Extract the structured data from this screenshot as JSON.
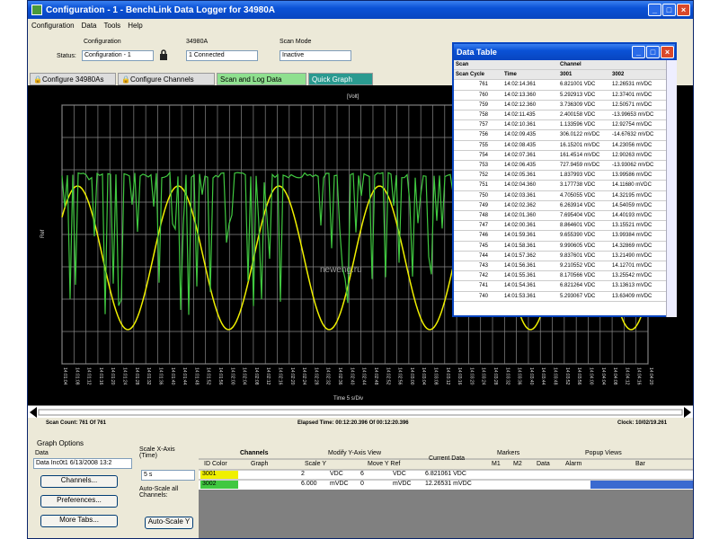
{
  "window": {
    "title": "Configuration - 1 - BenchLink Data Logger for 34980A",
    "buttons": [
      "_",
      "□",
      "×"
    ]
  },
  "menu": [
    "Configuration",
    "Data",
    "Tools",
    "Help"
  ],
  "config": {
    "configuration_label": "Configuration",
    "status_label": "Status:",
    "configuration_value": "Configuration - 1",
    "instrument_label": "34980A",
    "instrument_value": "1 Connected",
    "scan_mode_label": "Scan Mode",
    "scan_mode_value": "Inactive"
  },
  "tabs": [
    {
      "label": "Configure 34980As"
    },
    {
      "label": "Configure Channels"
    },
    {
      "label": "Scan and Log Data"
    },
    {
      "label": "Quick Graph"
    }
  ],
  "plot": {
    "top_label": "[Volt]",
    "y_label": "Ref",
    "x_label": "Time 5 s/Div",
    "legend": [
      "3001",
      "3002"
    ],
    "watermark": "neweng.ru",
    "time_ticks": [
      "14:01:04",
      "14:01:08",
      "14:01:12",
      "14:01:16",
      "14:01:20",
      "14:01:24",
      "14:01:28",
      "14:01:32",
      "14:01:36",
      "14:01:40",
      "14:01:44",
      "14:01:48",
      "14:01:52",
      "14:01:56",
      "14:02:00",
      "14:02:04",
      "14:02:08",
      "14:02:12",
      "14:02:16",
      "14:02:20",
      "14:02:24",
      "14:02:28",
      "14:02:32",
      "14:02:36",
      "14:02:40",
      "14:02:44",
      "14:02:48",
      "14:02:52",
      "14:02:56",
      "14:03:00",
      "14:03:04",
      "14:03:08",
      "14:03:12",
      "14:03:16",
      "14:03:20",
      "14:03:24",
      "14:03:28",
      "14:03:32",
      "14:03:36",
      "14:03:40",
      "14:03:44",
      "14:03:48",
      "14:03:52",
      "14:03:56",
      "14:04:00",
      "14:04:04",
      "14:04:08",
      "14:04:12",
      "14:04:16",
      "14:04:20"
    ],
    "colors": {
      "ch3001": "#f0f000",
      "ch3002": "#40c840",
      "grid": "#cccccc"
    }
  },
  "status_bar": {
    "scan_count": "Scan Count: 761 Of 761",
    "elapsed": "Elapsed Time: 00:12:20.396 Of 00:12:20.396",
    "clock": "Clock: 10/02/19.261"
  },
  "graph_options": {
    "title": "Graph Options",
    "data_label": "Data",
    "data_value": "Data Inc0t1 6/13/2008 13:2",
    "channels_btn": "Channels...",
    "preferences_btn": "Preferences...",
    "more_tabs_btn": "More Tabs...",
    "scale_label": "Scale X-Axis (Time)",
    "scale_value": "5 s",
    "autoscale_label": "Auto-Scale all Channels:",
    "autoscale_btn": "Auto-Scale Y"
  },
  "grid": {
    "headers": {
      "channels": "Channels",
      "id_color": "ID Color",
      "graph": "Graph",
      "modify": "Modify Y-Axis View",
      "scale_y": "Scale Y",
      "move_y": "Move Y Ref",
      "current": "Current Data",
      "markers": "Markers",
      "m1": "M1",
      "m2": "M2",
      "popup": "Popup Views",
      "data": "Data",
      "alarm": "Alarm",
      "bar": "Bar"
    },
    "rows": [
      {
        "id": "3001",
        "color": "#f0f000",
        "scale": "2",
        "scale_unit": "VDC",
        "move": "6",
        "move_unit": "VDC",
        "current": "6.821061 VDC"
      },
      {
        "id": "3002",
        "color": "#40c840",
        "scale": "6.000",
        "scale_unit": "mVDC",
        "move": "0",
        "move_unit": "mVDC",
        "current": "12.26531 mVDC"
      }
    ]
  },
  "data_table": {
    "title": "Data Table",
    "headers": {
      "scan": "Scan",
      "channel": "Channel",
      "scan_cycle": "Scan Cycle",
      "time": "Time",
      "c1": "3001",
      "c2": "3002"
    },
    "rows": [
      [
        "761",
        "14:02:14.361",
        "6.821001 VDC",
        "12.26531 mVDC"
      ],
      [
        "760",
        "14:02:13.360",
        "5.292913 VDC",
        "12.37401 mVDC"
      ],
      [
        "759",
        "14:02:12.360",
        "3.736309 VDC",
        "12.50571 mVDC"
      ],
      [
        "758",
        "14:02:11.435",
        "2.400158 VDC",
        "-13.99653 mVDC"
      ],
      [
        "757",
        "14:02:10.361",
        "1.133596 VDC",
        "12.92754 mVDC"
      ],
      [
        "756",
        "14:02:09.435",
        "306.0122 mVDC",
        "-14.67632 mVDC"
      ],
      [
        "755",
        "14:02:08.435",
        "16.15201 mVDC",
        "14.23056 mVDC"
      ],
      [
        "754",
        "14:02:07.361",
        "161.4514 mVDC",
        "12.90263 mVDC"
      ],
      [
        "753",
        "14:02:06.435",
        "727.9459 mVDC",
        "-13.93062 mVDC"
      ],
      [
        "752",
        "14:02:05.361",
        "1.837993 VDC",
        "13.99586 mVDC"
      ],
      [
        "751",
        "14:02:04.360",
        "3.177738 VDC",
        "14.11680 mVDC"
      ],
      [
        "750",
        "14:02:03.361",
        "4.705055 VDC",
        "14.32195 mVDC"
      ],
      [
        "749",
        "14:02:02.362",
        "6.263914 VDC",
        "14.54059 mVDC"
      ],
      [
        "748",
        "14:02:01.360",
        "7.695404 VDC",
        "14.40193 mVDC"
      ],
      [
        "747",
        "14:02:00.361",
        "8.864601 VDC",
        "13.15521 mVDC"
      ],
      [
        "746",
        "14:01:59.361",
        "9.655390 VDC",
        "13.99384 mVDC"
      ],
      [
        "745",
        "14:01:58.361",
        "9.990605 VDC",
        "14.32869 mVDC"
      ],
      [
        "744",
        "14:01:57.362",
        "9.837601 VDC",
        "13.21490 mVDC"
      ],
      [
        "743",
        "14:01:56.361",
        "9.210552 VDC",
        "14.12701 mVDC"
      ],
      [
        "742",
        "14:01:55.361",
        "8.170566 VDC",
        "13.25542 mVDC"
      ],
      [
        "741",
        "14:01:54.361",
        "6.821264 VDC",
        "13.13613 mVDC"
      ],
      [
        "740",
        "14:01:53.361",
        "5.293067 VDC",
        "13.63409 mVDC"
      ]
    ]
  }
}
